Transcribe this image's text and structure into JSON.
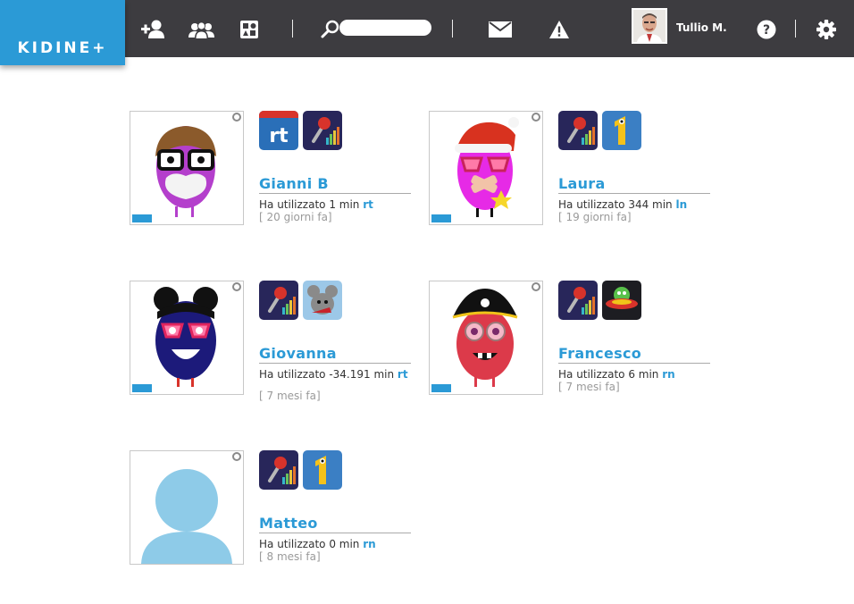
{
  "header": {
    "logo_text": "KIDINE+",
    "search": {
      "value": "",
      "placeholder": ""
    },
    "user": {
      "name": "Tullio M."
    },
    "icons": [
      "add-user-icon",
      "group-icon",
      "apps-icon",
      "search-icon",
      "mail-icon",
      "warning-icon",
      "help-icon",
      "settings-icon"
    ],
    "colors": {
      "bar": "#3d3c40",
      "brand": "#2b9ad6"
    }
  },
  "children": [
    {
      "name": "Gianni B",
      "usage_prefix": "Ha utilizzato 1 min",
      "usage_app": "rt",
      "last_seen": "[ 20 giorni fa]",
      "apps": [
        "rt-icon",
        "microphone-icon"
      ]
    },
    {
      "name": "Laura",
      "usage_prefix": "Ha utilizzato 344 min",
      "usage_app": "ln",
      "last_seen": "[ 19 giorni fa]",
      "apps": [
        "microphone-icon",
        "number-one-icon"
      ]
    },
    {
      "name": "Giovanna",
      "usage_prefix": "Ha utilizzato -34.191 min",
      "usage_app": "rt",
      "last_seen": "[ 7 mesi fa]",
      "apps": [
        "microphone-icon",
        "mouse-icon"
      ]
    },
    {
      "name": "Francesco",
      "usage_prefix": "Ha utilizzato 6 min",
      "usage_app": "rn",
      "last_seen": "[ 7 mesi fa]",
      "apps": [
        "microphone-icon",
        "ufo-icon"
      ]
    },
    {
      "name": "Matteo",
      "usage_prefix": "Ha utilizzato 0 min",
      "usage_app": "rn",
      "last_seen": "[ 8 mesi fa]",
      "apps": [
        "microphone-icon",
        "number-one-icon"
      ]
    }
  ]
}
